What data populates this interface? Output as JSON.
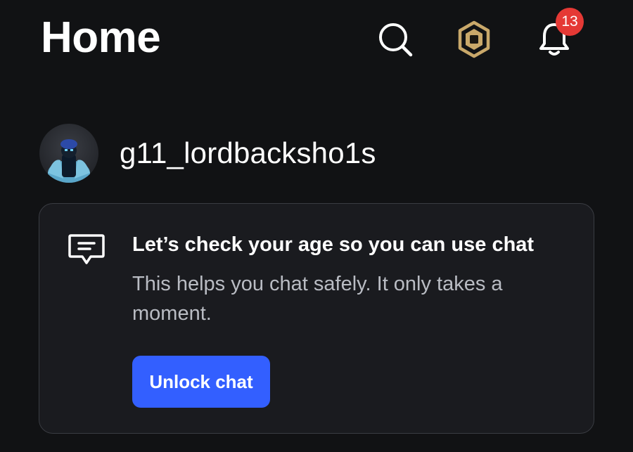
{
  "header": {
    "title": "Home",
    "icons": {
      "search": "search-icon",
      "robux": "robux-icon",
      "notifications": "bell-icon"
    },
    "notification_count": "13"
  },
  "profile": {
    "username": "g11_lordbacksho1s"
  },
  "age_check_card": {
    "icon": "chat-bubble-icon",
    "title": "Let’s check your age so you can use chat",
    "body": "This helps you chat safely. It only takes a moment.",
    "button_label": "Unlock chat"
  },
  "colors": {
    "background": "#111214",
    "card_background": "#1a1b1f",
    "card_border": "#3a3c42",
    "primary_button": "#335fff",
    "badge": "#e53935",
    "robux_gold": "#c9a86a",
    "muted_text": "#b9bcc3"
  }
}
